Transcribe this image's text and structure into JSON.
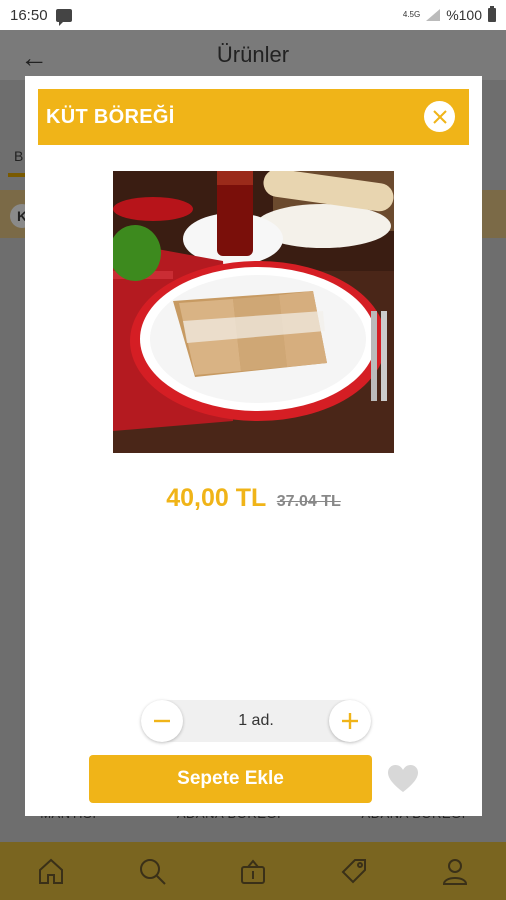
{
  "status_bar": {
    "time": "16:50",
    "network": "4.5G",
    "battery": "%100"
  },
  "background": {
    "header_title": "Ürünler",
    "back_icon": "arrow-left-icon",
    "tab_label": "B",
    "category_label": "K",
    "product_names": [
      "MANTISI",
      "ADANA BÖREĞİ",
      "ADANA BÖREĞİ"
    ],
    "bottom_nav": [
      "home-icon",
      "search-icon",
      "basket-icon",
      "tag-icon",
      "user-icon"
    ]
  },
  "modal": {
    "title": "KÜT BÖREĞİ",
    "close_icon": "close-icon",
    "price_new": "40,00 TL",
    "price_old": "37.04 TL",
    "quantity": "1 ad.",
    "add_to_cart": "Sepete Ekle",
    "favorite_icon": "heart-icon"
  },
  "colors": {
    "accent": "#f0b418",
    "overlay": "#6e6e6e"
  }
}
